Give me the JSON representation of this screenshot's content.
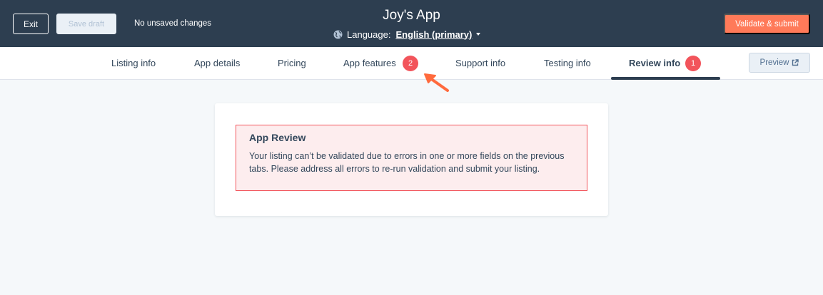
{
  "topbar": {
    "exit_label": "Exit",
    "save_draft_label": "Save draft",
    "unsaved_status": "No unsaved changes",
    "app_title": "Joy's App",
    "language_label": "Language:",
    "language_value": "English (primary)",
    "validate_label": "Validate & submit"
  },
  "tabs": [
    {
      "label": "Listing info"
    },
    {
      "label": "App details"
    },
    {
      "label": "Pricing"
    },
    {
      "label": "App features",
      "badge": "2"
    },
    {
      "label": "Support info"
    },
    {
      "label": "Testing info"
    },
    {
      "label": "Review info",
      "badge": "1",
      "active": true
    }
  ],
  "preview_label": "Preview",
  "alert": {
    "title": "App Review",
    "body": "Your listing can’t be validated due to errors in one or more fields on the previous tabs. Please address all errors to re-run validation and submit your listing."
  },
  "colors": {
    "header_bg": "#2d3e50",
    "accent": "#ff7a59",
    "badge": "#f2545b",
    "alert_bg": "#fdedee",
    "alert_border": "#f2545b",
    "page_bg": "#f5f8fa"
  },
  "icons": {
    "globe": "globe-icon",
    "caret": "caret-down-icon",
    "external": "external-link-icon",
    "arrow": "pointer-arrow-icon"
  }
}
